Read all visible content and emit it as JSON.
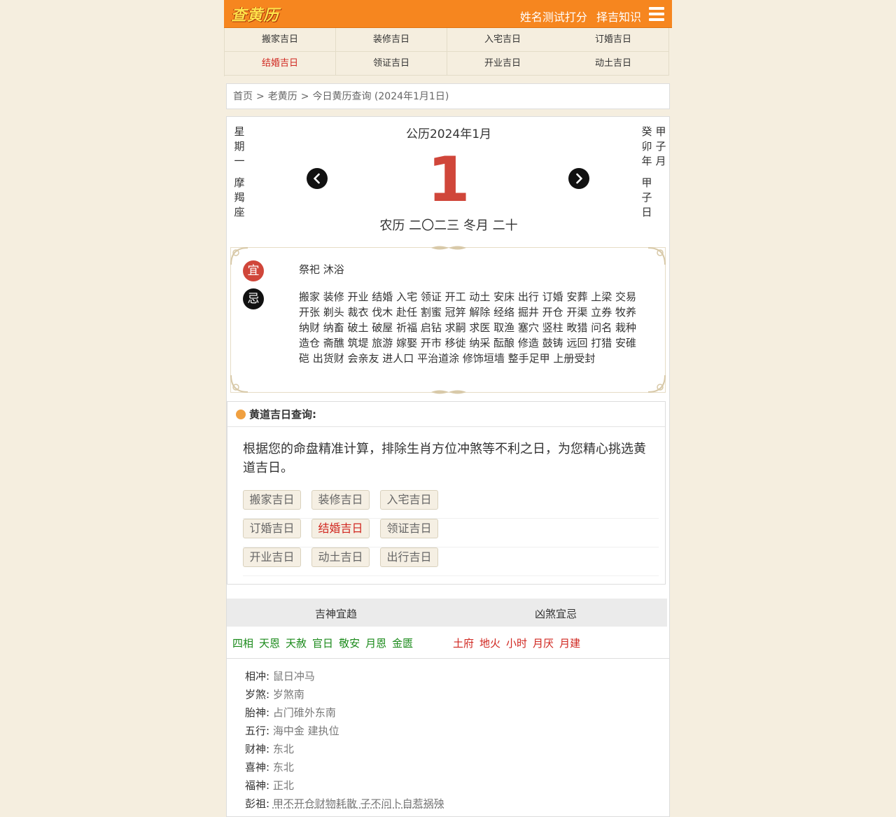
{
  "header": {
    "logo": "查黄历",
    "links": [
      "姓名测试打分",
      "择吉知识"
    ]
  },
  "nav": [
    "搬家吉日",
    "装修吉日",
    "入宅吉日",
    "订婚吉日",
    "结婚吉日",
    "领证吉日",
    "开业吉日",
    "动土吉日"
  ],
  "nav_active_index": 4,
  "breadcrumb": {
    "items": [
      "首页",
      "老黄历",
      "今日黄历查询 (2024年1月1日)"
    ],
    "separator": ">"
  },
  "calendar": {
    "weekday": "星期一",
    "zodiac_sign": "摩羯座",
    "title": "公历2024年1月",
    "day": "1",
    "lunar": "农历 二〇二三 冬月 二十",
    "ganzhi_year": "癸卯年",
    "ganzhi_month": "甲子月",
    "ganzhi_day": "甲子日"
  },
  "yiji": {
    "yi_label": "宜",
    "yi": "祭祀 沐浴",
    "ji_label": "忌",
    "ji": "搬家 装修 开业 结婚 入宅 领证 开工 动土 安床 出行 订婚 安葬 上梁 交易 开张 剃头 裁衣 伐木 赴任 割蜜 冠笄 解除 经络 掘井 开仓 开渠 立券 牧养 纳财 纳畜 破土 破屋 祈福 启钻 求嗣 求医 取渔 塞穴 竖柱 畋猎 问名 栽种 造仓 斋醮 筑堤 旅游 嫁娶 开市 移徙 纳采 酝酿 修造 鼓铸 远回 打猎 安碓硙 出货财 会亲友 进人口 平治道涂 修饰垣墙 整手足甲 上册受封"
  },
  "query": {
    "title": "黄道吉日查询:",
    "description": "根据您的命盘精准计算，排除生肖方位冲煞等不利之日，为您精心挑选黄道吉日。",
    "buttons": [
      [
        "搬家吉日",
        "装修吉日",
        "入宅吉日"
      ],
      [
        "订婚吉日",
        "结婚吉日",
        "领证吉日"
      ],
      [
        "开业吉日",
        "动土吉日",
        "出行吉日"
      ]
    ],
    "active_button": "结婚吉日"
  },
  "gods": {
    "good_header": "吉神宜趋",
    "bad_header": "凶煞宜忌",
    "good": [
      "四相",
      "天恩",
      "天赦",
      "官日",
      "敬安",
      "月恩",
      "金匮"
    ],
    "bad": [
      "土府",
      "地火",
      "小时",
      "月厌",
      "月建"
    ]
  },
  "info": [
    {
      "label": "相冲:",
      "value": "鼠日冲马"
    },
    {
      "label": "岁煞:",
      "value": "岁煞南"
    },
    {
      "label": "胎神:",
      "value": "占门碓外东南"
    },
    {
      "label": "五行:",
      "value": "海中金 建执位"
    },
    {
      "label": "财神:",
      "value": "东北"
    },
    {
      "label": "喜神:",
      "value": "东北"
    },
    {
      "label": "福神:",
      "value": "正北"
    },
    {
      "label": "彭祖:",
      "value": "甲不开仓财物耗散 子不问卜自惹祸殃"
    }
  ],
  "colors": {
    "header_orange": "#f6861f",
    "day_red": "#d0463a",
    "active_red": "#d0261f",
    "good_green": "#1a8a1a",
    "page_bg": "#f5eedf"
  }
}
